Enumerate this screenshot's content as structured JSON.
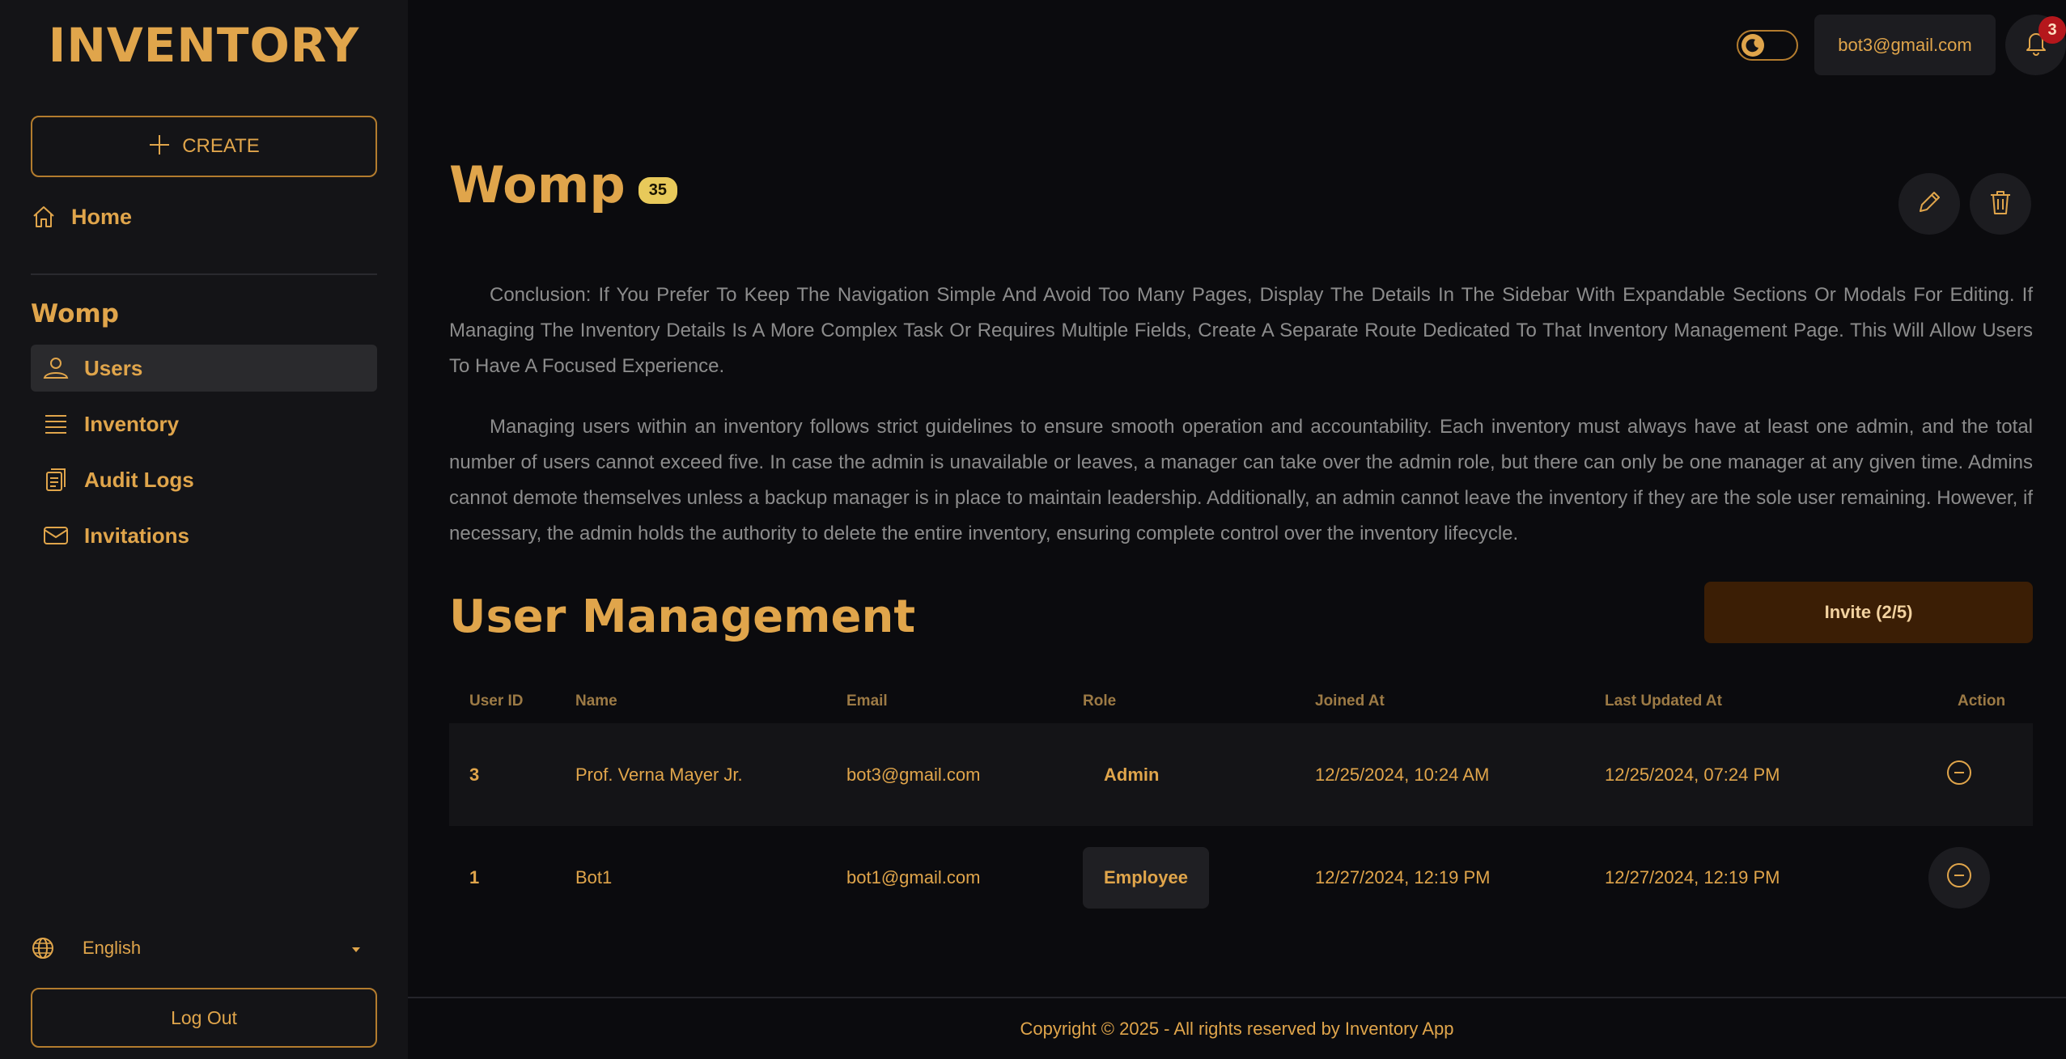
{
  "sidebar": {
    "brand": "INVENTORY",
    "create_label": "CREATE",
    "home_label": "Home",
    "section_title": "Womp",
    "items": [
      {
        "label": "Users",
        "icon": "users-icon",
        "active": true
      },
      {
        "label": "Inventory",
        "icon": "list-icon",
        "active": false
      },
      {
        "label": "Audit Logs",
        "icon": "clipboard-icon",
        "active": false
      },
      {
        "label": "Invitations",
        "icon": "mail-icon",
        "active": false
      }
    ],
    "language": "English",
    "logout_label": "Log Out"
  },
  "header": {
    "user_email": "bot3@gmail.com",
    "notification_count": "3"
  },
  "main": {
    "title": "Womp",
    "count_badge": "35",
    "description_1": "Conclusion: If You Prefer To Keep The Navigation Simple And Avoid Too Many Pages, Display The Details In The Sidebar With Expandable Sections Or Modals For Editing. If Managing The Inventory Details Is A More Complex Task Or Requires Multiple Fields, Create A Separate Route Dedicated To That Inventory Management Page. This Will Allow Users To Have A Focused Experience.",
    "description_2": "Managing users within an inventory follows strict guidelines to ensure smooth operation and accountability. Each inventory must always have at least one admin, and the total number of users cannot exceed five. In case the admin is unavailable or leaves, a manager can take over the admin role, but there can only be one manager at any given time. Admins cannot demote themselves unless a backup manager is in place to maintain leadership. Additionally, an admin cannot leave the inventory if they are the sole user remaining. However, if necessary, the admin holds the authority to delete the entire inventory, ensuring complete control over the inventory lifecycle.",
    "section_title": "User Management",
    "invite_label": "Invite (2/5)"
  },
  "table": {
    "headers": [
      "User ID",
      "Name",
      "Email",
      "Role",
      "Joined At",
      "Last Updated At",
      "Action"
    ],
    "rows": [
      {
        "id": "3",
        "name": "Prof. Verna Mayer Jr.",
        "email": "bot3@gmail.com",
        "role": "Admin",
        "joined": "12/25/2024, 10:24 AM",
        "updated": "12/25/2024, 07:24 PM"
      },
      {
        "id": "1",
        "name": "Bot1",
        "email": "bot1@gmail.com",
        "role": "Employee",
        "joined": "12/27/2024, 12:19 PM",
        "updated": "12/27/2024, 12:19 PM"
      }
    ]
  },
  "footer": {
    "text": "Copyright © 2025 - All rights reserved by Inventory App"
  },
  "colors": {
    "accent": "#e0a54b",
    "background": "#0b0b0e",
    "sidebar": "#141417",
    "invite_button": "#3b1e05",
    "badge": "#e8c95a",
    "notification": "#b5171c"
  }
}
